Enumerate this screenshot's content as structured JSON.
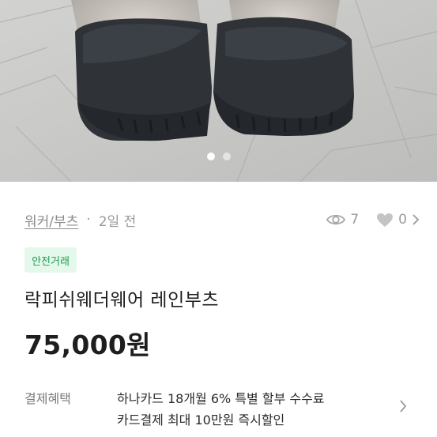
{
  "product": {
    "category": "워커/부츠",
    "separator": "·",
    "time_ago": "2일 전",
    "views": "7",
    "likes": "0",
    "safe_badge": "안전거래",
    "title": "락피쉬웨더웨어 레인부츠",
    "price": "75,000원"
  },
  "benefit": {
    "label": "결제혜택",
    "line1": "하나카드 18개월 6% 특별 할부 수수료",
    "line2": "카드결제 최대 10만원 즉시할인"
  },
  "carousel": {
    "total": 2,
    "active": 1
  },
  "colors": {
    "safe_bg": "#e5f8ec",
    "safe_text": "#1f9d52",
    "muted": "#9a9a9a"
  },
  "icons": [
    "eye-icon",
    "heart-icon",
    "chevron-right-icon"
  ]
}
